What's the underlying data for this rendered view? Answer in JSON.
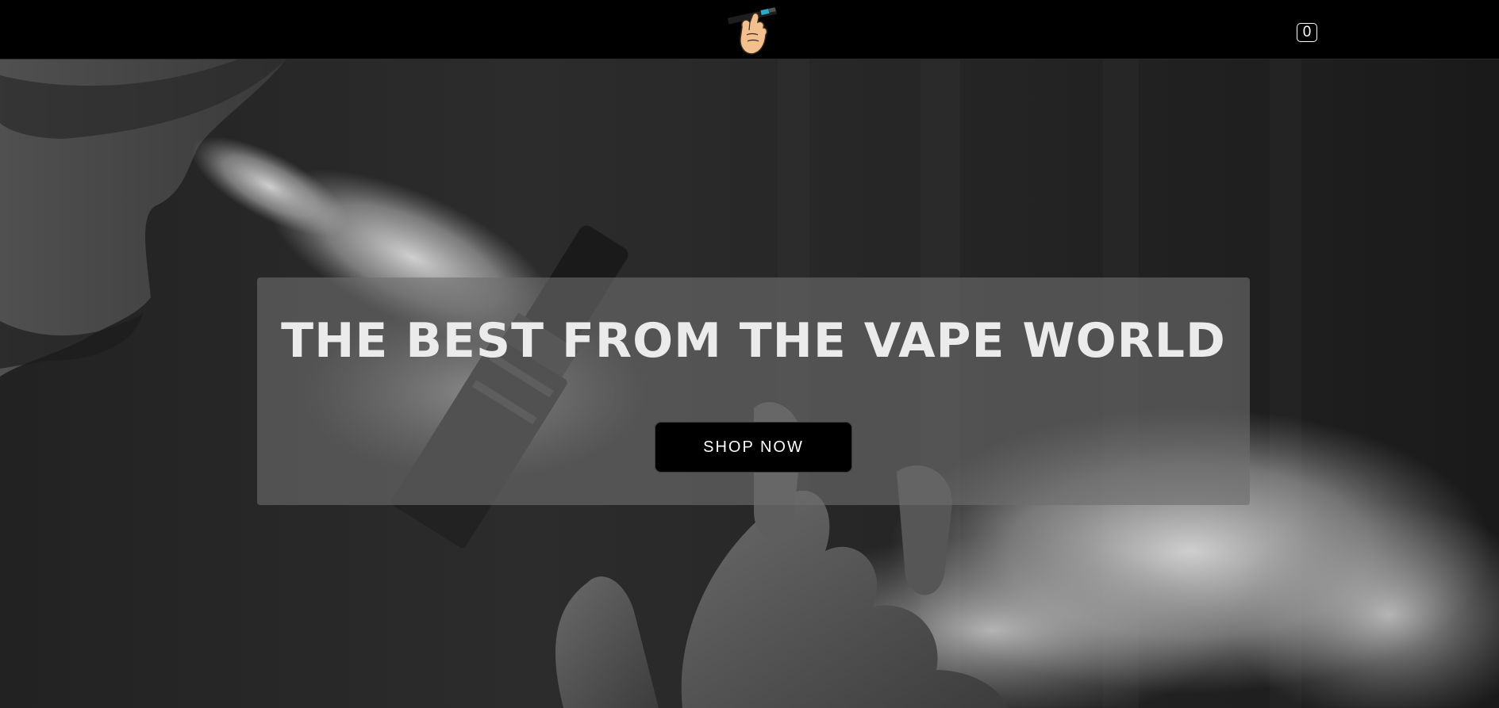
{
  "header": {
    "logo_icon": "hand-holding-vape-icon",
    "cart_count": "0"
  },
  "hero": {
    "background_icon": "vaping-person-photo",
    "title": "THE BEST FROM THE VAPE WORLD",
    "cta_label": "SHOP NOW"
  },
  "colors": {
    "navbar": "#000000",
    "panel": "#6e6e6e",
    "button": "#000000",
    "title_text": "#ebebeb"
  }
}
